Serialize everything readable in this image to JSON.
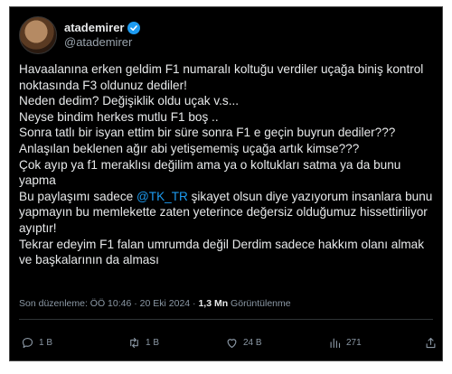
{
  "author": {
    "display_name": "atademirer",
    "handle": "@atademirer"
  },
  "tweet": {
    "lines": [
      "Havaalanına erken geldim F1 numaralı koltuğu verdiler uçağa biniş kontrol noktasında F3 oldunuz dediler!",
      "Neden dedim? Değişiklik oldu uçak v.s...",
      "Neyse bindim herkes mutlu F1 boş ..",
      "Sonra tatlı bir isyan ettim bir süre sonra F1 e geçin buyrun dediler???",
      "Anlaşılan beklenen ağır abi yetişememiş uçağa artık kimse???",
      "Çok ayıp ya f1 meraklısı değilim ama ya o koltukları satma ya da bunu yapma"
    ],
    "mention_prefix": "Bu paylaşımı sadece ",
    "mention": "@TK_TR",
    "mention_suffix": " şikayet olsun diye yazıyorum  insanlara bunu yapmayın bu memlekette zaten yeterince değersiz olduğumuz hissettiriliyor ayıptır!",
    "closing": "Tekrar edeyim F1 falan umrumda değil  Derdim sadece hakkım olanı almak ve başkalarının da alması"
  },
  "meta": {
    "edited_text": "Son düzenleme: ÖÖ 10:46 · 20 Eki 2024 · ",
    "views_count": "1,3 Mn",
    "views_label": " Görüntülenme"
  },
  "actions": {
    "replies": "1 B",
    "retweets": "1 B",
    "likes": "24 B",
    "views": "271"
  },
  "colors": {
    "background": "#000000",
    "text": "#e7e9ea",
    "muted": "#8b98a5",
    "accent": "#1d9bf0"
  }
}
